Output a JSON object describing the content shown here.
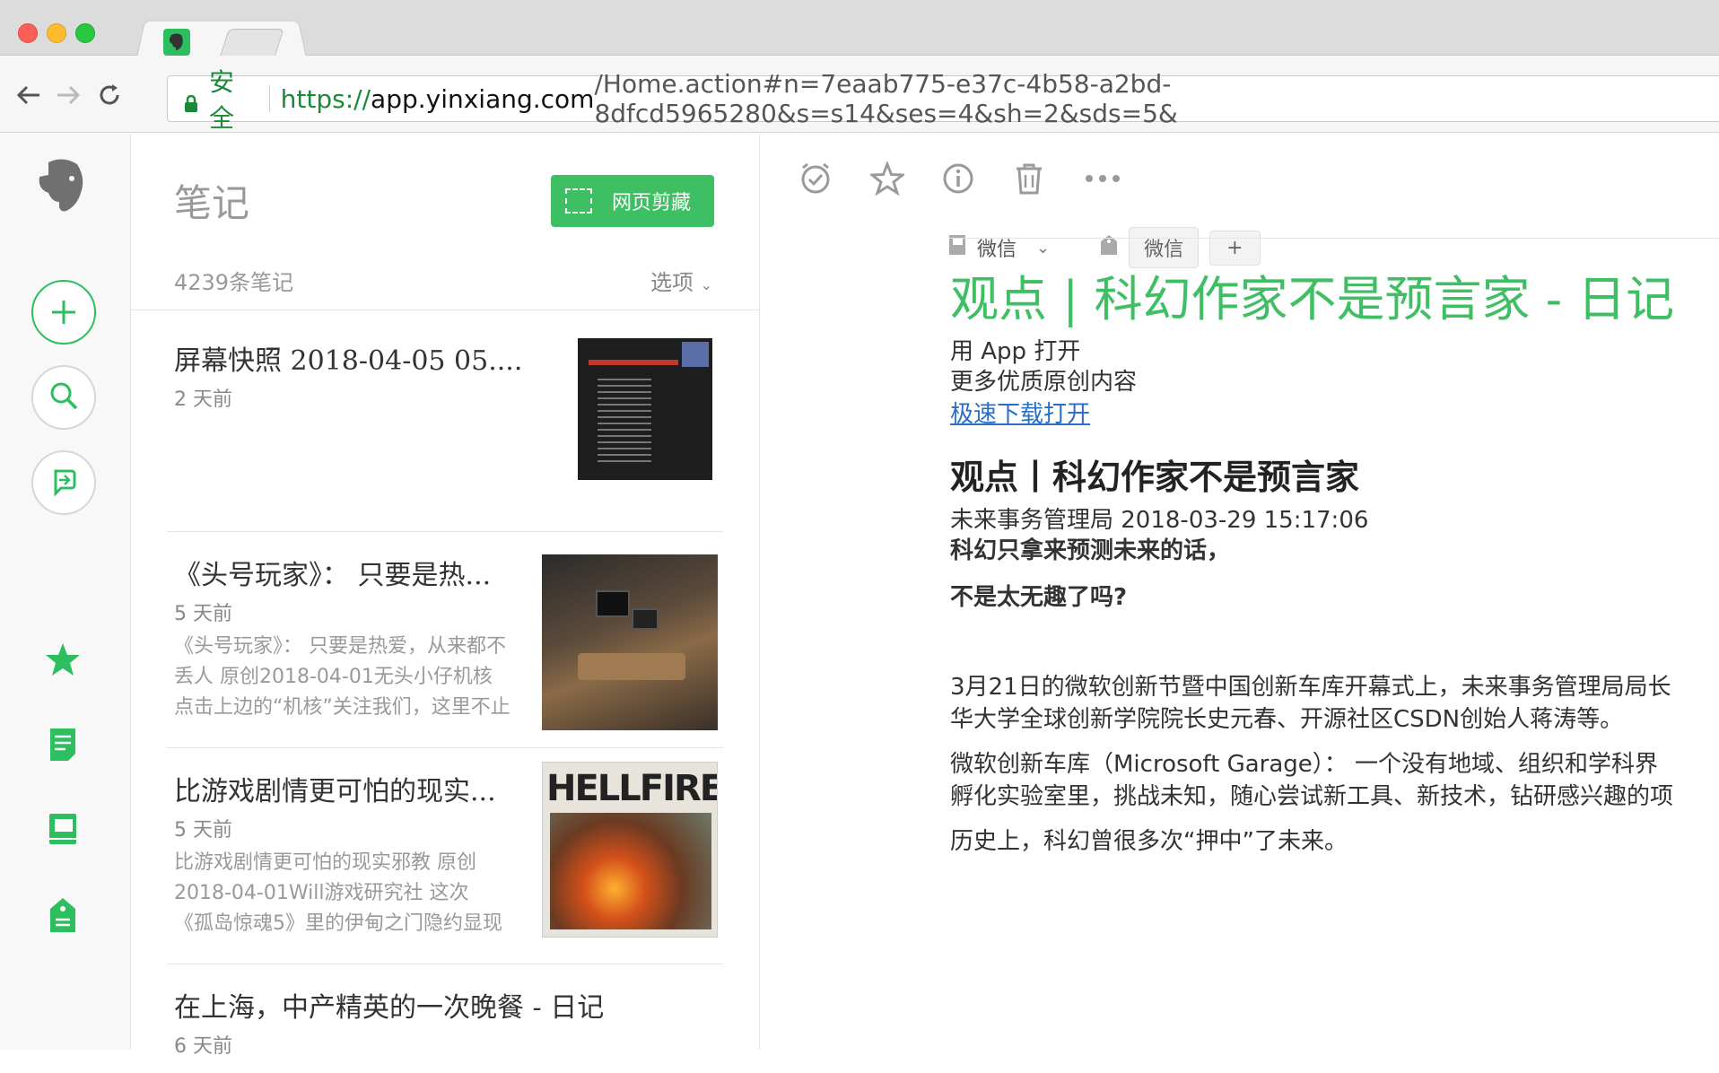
{
  "browser": {
    "security_label": "安全",
    "url_scheme": "https://",
    "url_host": "app.yinxiang.com",
    "url_rest": "/Home.action#n=7eaab775-e37c-4b58-a2bd-8dfcd5965280&s=s14&ses=4&sh=2&sds=5&"
  },
  "notes_panel": {
    "title": "笔记",
    "clip_button": "网页剪藏",
    "count": "4239条笔记",
    "options": "选项",
    "notes": [
      {
        "title": "屏幕快照 2018-04-05 05....",
        "date": "2 天前",
        "snippet": []
      },
      {
        "title": "《头号玩家》： 只要是热...",
        "date": "5 天前",
        "snippet": [
          "《头号玩家》： 只要是热爱，从来都不",
          "丢人 原创2018-04-01无头小仔机核",
          "点击上边的“机核”关注我们，这里不止"
        ]
      },
      {
        "title": "比游戏剧情更可怕的现实...",
        "date": "5 天前",
        "snippet": [
          "比游戏剧情更可怕的现实邪教 原创",
          "2018-04-01Will游戏研究社 这次",
          "《孤岛惊魂5》里的伊甸之门隐约显现"
        ],
        "thumb_text": "HELLFIRE"
      },
      {
        "title": "在上海，中产精英的一次晚餐 - 日记",
        "date": "6 天前",
        "snippet": []
      }
    ]
  },
  "note_view": {
    "notebook": "微信",
    "tag": "微信",
    "add_tag": "+",
    "title": "观点 | 科幻作家不是预言家 - 日记",
    "open_app": "用 App 打开",
    "more_content": "更多优质原创内容",
    "download_link": "极速下载打开",
    "article_title": "观点丨科幻作家不是预言家",
    "byline": "未来事务管理局 2018-03-29 15:17:06",
    "lead1": "科幻只拿来预测未来的话，",
    "lead2": "不是太无趣了吗?",
    "para1_l1": "3月21日的微软创新节暨中国创新车库开幕式上，未来事务管理局局长",
    "para1_l2": "华大学全球创新学院院长史元春、开源社区CSDN创始人蒋涛等。",
    "para2_l1": "微软创新车库（Microsoft Garage）： 一个没有地域、组织和学科界",
    "para2_l2": "孵化实验室里，挑战未知，随心尝试新工具、新技术，钻研感兴趣的项",
    "para3": "历史上，科幻曾很多次“押中”了未来。"
  },
  "colors": {
    "accent": "#3fbf63",
    "link": "#2a6ec7"
  }
}
